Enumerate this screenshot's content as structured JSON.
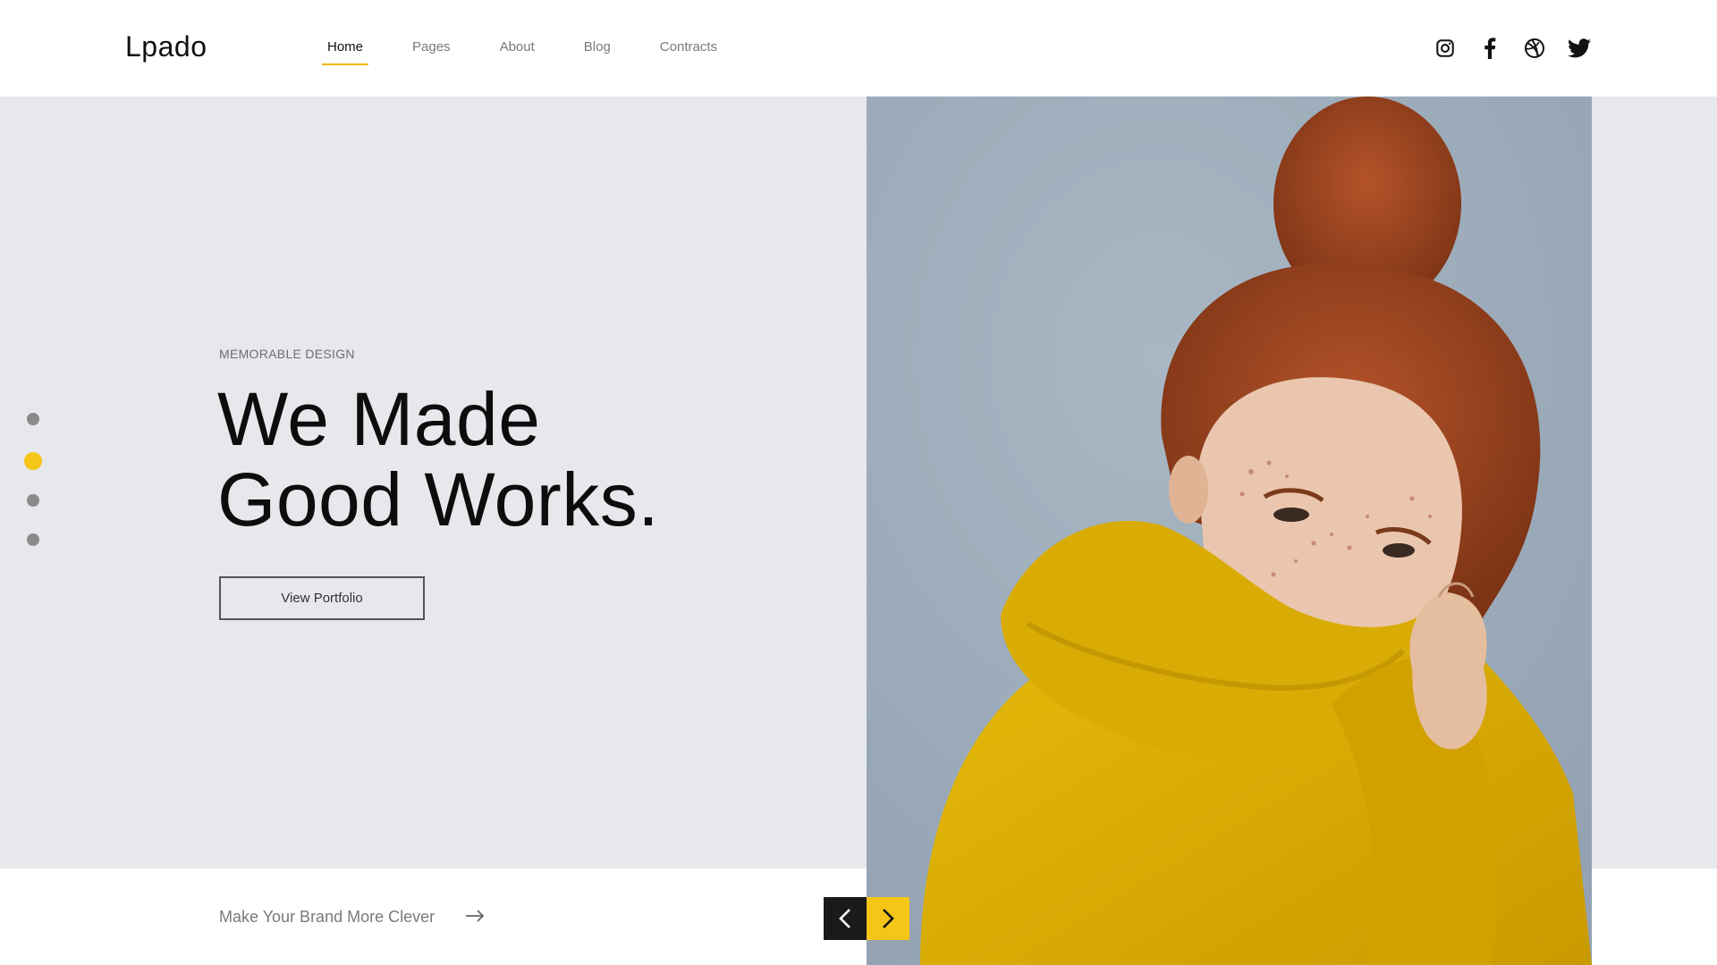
{
  "header": {
    "logo": "Lpado",
    "nav": [
      {
        "label": "Home",
        "active": true
      },
      {
        "label": "Pages",
        "active": false
      },
      {
        "label": "About",
        "active": false
      },
      {
        "label": "Blog",
        "active": false
      },
      {
        "label": "Contracts",
        "active": false
      }
    ],
    "socials": [
      "instagram-icon",
      "facebook-icon",
      "dribbble-icon",
      "twitter-icon"
    ]
  },
  "hero": {
    "eyebrow": "MEMORABLE DESIGN",
    "headline_line1": "We Made",
    "headline_line2": "Good Works.",
    "button_label": "View Portfolio",
    "slide_indicator": {
      "count": 4,
      "active_index": 1
    }
  },
  "bottom": {
    "link_text": "Make Your Brand More Clever",
    "link_icon": "arrow-right-icon",
    "prev_icon": "chevron-left-icon",
    "next_icon": "chevron-right-icon"
  },
  "colors": {
    "accent": "#f5c518",
    "hero_background": "#e7e8ec",
    "photo_background": "#9eadbb",
    "sweater": "#e3b400",
    "hair": "#a4461e"
  }
}
